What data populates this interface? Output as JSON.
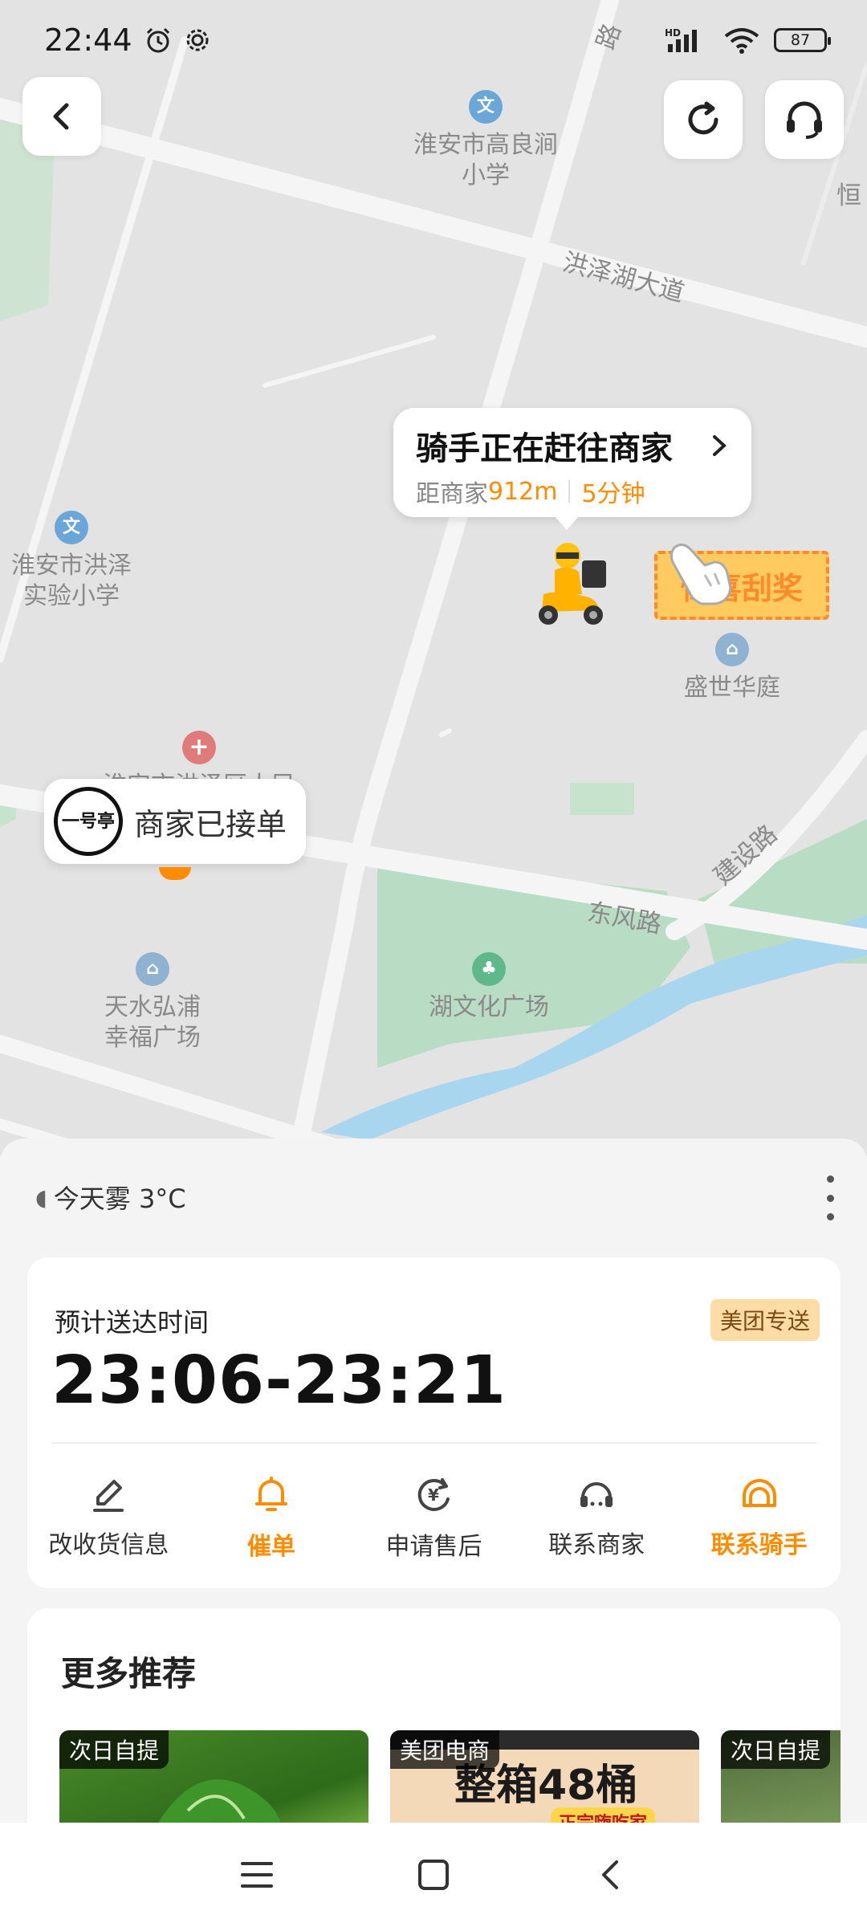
{
  "status_bar": {
    "time": "22:44",
    "battery": "87",
    "network": "HD"
  },
  "map": {
    "pois": {
      "school1": "淮安市高良涧\n小学",
      "school2": "淮安市洪泽\n实验小学",
      "shengshi": "盛世华庭",
      "hospital": "淮安市洪泽区人民",
      "tianshui": "天水弘浦\n幸福广场",
      "park": "湖文化广场"
    },
    "roads": {
      "hongze": "洪泽湖大道",
      "dongfeng": "东风路",
      "jianshe": "建设路",
      "top_road": "路",
      "heng": "恒"
    },
    "rider_bubble": {
      "title": "骑手正在赶往商家",
      "distance_label": "距商家",
      "distance": "912m",
      "time": "5分钟"
    },
    "scratch_badge": "惊喜刮奖",
    "merchant_bubble": {
      "logo_text": "一号亭",
      "status": "商家已接单"
    }
  },
  "side_tab": "〉",
  "sheet": {
    "weather": "今天雾 3°C",
    "delivery": {
      "eta_label": "预计送达时间",
      "eta_time": "23:06-23:21",
      "brand_badge": "美团专送",
      "actions": [
        {
          "label": "改收货信息",
          "icon": "edit-icon"
        },
        {
          "label": "催单",
          "icon": "bell-icon"
        },
        {
          "label": "申请售后",
          "icon": "refund-icon"
        },
        {
          "label": "联系商家",
          "icon": "merchant-headset-icon"
        },
        {
          "label": "联系骑手",
          "icon": "rider-helmet-icon"
        }
      ]
    },
    "recommend": {
      "title": "更多推荐",
      "items": [
        {
          "tag": "次日自提"
        },
        {
          "tag": "美团电商",
          "banner_text": "整箱48桶",
          "banner_sub": "正宗嗨吃家"
        },
        {
          "tag": "次日自提"
        }
      ]
    }
  },
  "colors": {
    "accent": "#ff8b00",
    "map_bg": "#e3e3e3",
    "park_green": "#b9dcc4",
    "water": "#a9d6ef"
  }
}
